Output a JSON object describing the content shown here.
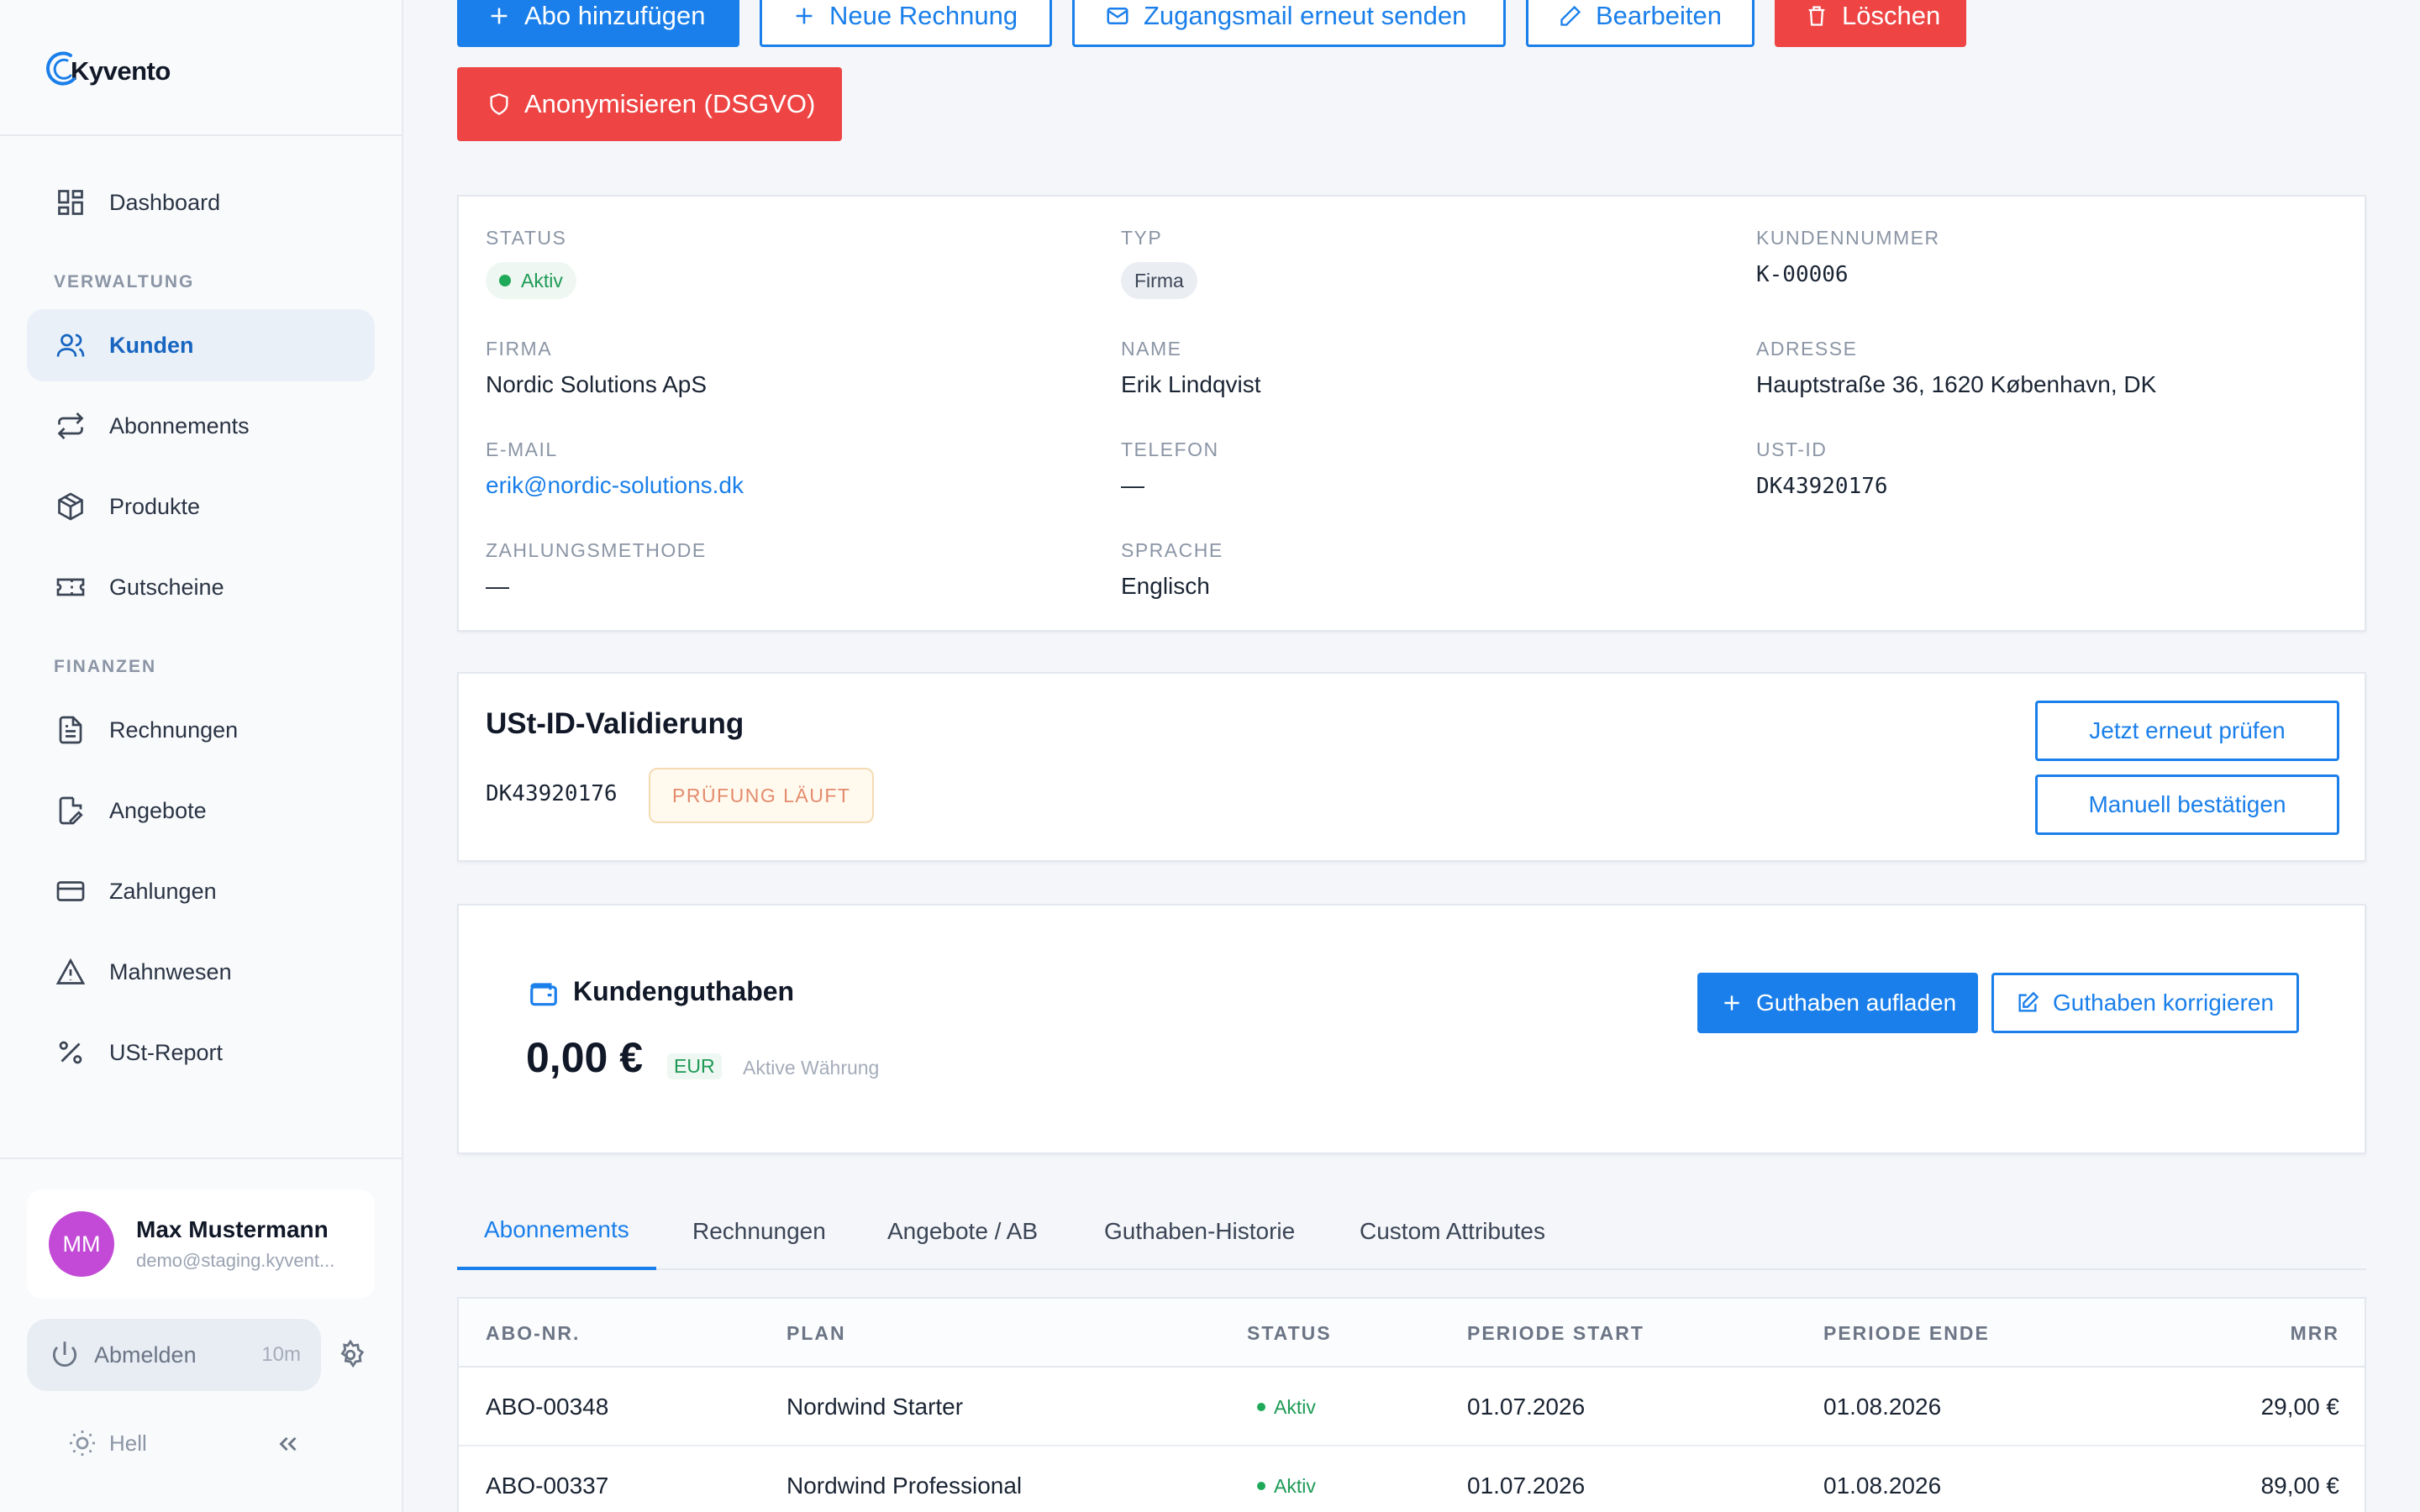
{
  "brand": {
    "name": "Kyvento"
  },
  "sidebar": {
    "items": [
      {
        "label": "Dashboard",
        "icon": "dashboard-icon"
      },
      {
        "label": "Kunden",
        "icon": "users-icon",
        "active": true
      },
      {
        "label": "Abonnements",
        "icon": "repeat-icon"
      },
      {
        "label": "Produkte",
        "icon": "package-icon"
      },
      {
        "label": "Gutscheine",
        "icon": "ticket-icon"
      },
      {
        "label": "Rechnungen",
        "icon": "file-text-icon"
      },
      {
        "label": "Angebote",
        "icon": "file-edit-icon"
      },
      {
        "label": "Zahlungen",
        "icon": "credit-card-icon"
      },
      {
        "label": "Mahnwesen",
        "icon": "alert-triangle-icon"
      },
      {
        "label": "USt-Report",
        "icon": "percent-icon"
      }
    ],
    "sections": {
      "verwaltung": "VERWALTUNG",
      "finanzen": "FINANZEN"
    },
    "user": {
      "initials": "MM",
      "name": "Max Mustermann",
      "email": "demo@staging.kyvent..."
    },
    "logout": {
      "label": "Abmelden",
      "time": "10m"
    },
    "theme": {
      "label": "Hell"
    }
  },
  "actions": {
    "add_subscription": "Abo hinzufügen",
    "new_invoice": "Neue Rechnung",
    "resend_mail": "Zugangsmail erneut senden",
    "edit": "Bearbeiten",
    "delete": "Löschen",
    "anonymize": "Anonymisieren (DSGVO)"
  },
  "customer": {
    "status_label": "STATUS",
    "status": "Aktiv",
    "type_label": "TYP",
    "type": "Firma",
    "number_label": "KUNDENNUMMER",
    "number": "K-00006",
    "company_label": "FIRMA",
    "company": "Nordic Solutions ApS",
    "name_label": "NAME",
    "name": "Erik Lindqvist",
    "address_label": "ADRESSE",
    "address": "Hauptstraße 36, 1620 København, DK",
    "email_label": "E-MAIL",
    "email": "erik@nordic-solutions.dk",
    "phone_label": "TELEFON",
    "phone": "—",
    "vat_label": "UST-ID",
    "vat": "DK43920176",
    "payment_label": "ZAHLUNGSMETHODE",
    "payment": "—",
    "language_label": "SPRACHE",
    "language": "Englisch"
  },
  "vat_validation": {
    "title": "USt-ID-Validierung",
    "vat_id": "DK43920176",
    "status": "PRÜFUNG LÄUFT",
    "recheck_label": "Jetzt erneut prüfen",
    "confirm_label": "Manuell bestätigen"
  },
  "credit": {
    "title": "Kundenguthaben",
    "amount": "0,00 €",
    "currency": "EUR",
    "currency_note": "Aktive Währung",
    "topup_label": "Guthaben aufladen",
    "correct_label": "Guthaben korrigieren"
  },
  "tabs": [
    {
      "label": "Abonnements",
      "active": true
    },
    {
      "label": "Rechnungen"
    },
    {
      "label": "Angebote / AB"
    },
    {
      "label": "Guthaben-Historie"
    },
    {
      "label": "Custom Attributes"
    }
  ],
  "subscriptions_table": {
    "headers": {
      "number": "ABO-NR.",
      "plan": "PLAN",
      "status": "STATUS",
      "start": "PERIODE START",
      "end": "PERIODE ENDE",
      "mrr": "MRR"
    },
    "rows": [
      {
        "number": "ABO-00348",
        "plan": "Nordwind Starter",
        "status": "Aktiv",
        "start": "01.07.2026",
        "end": "01.08.2026",
        "mrr": "29,00 €"
      },
      {
        "number": "ABO-00337",
        "plan": "Nordwind Professional",
        "status": "Aktiv",
        "start": "01.07.2026",
        "end": "01.08.2026",
        "mrr": "89,00 €"
      }
    ]
  },
  "colors": {
    "accent": "#1a7fea",
    "danger": "#ee4444",
    "success": "#1faa59",
    "avatar": "#c24ad6"
  }
}
